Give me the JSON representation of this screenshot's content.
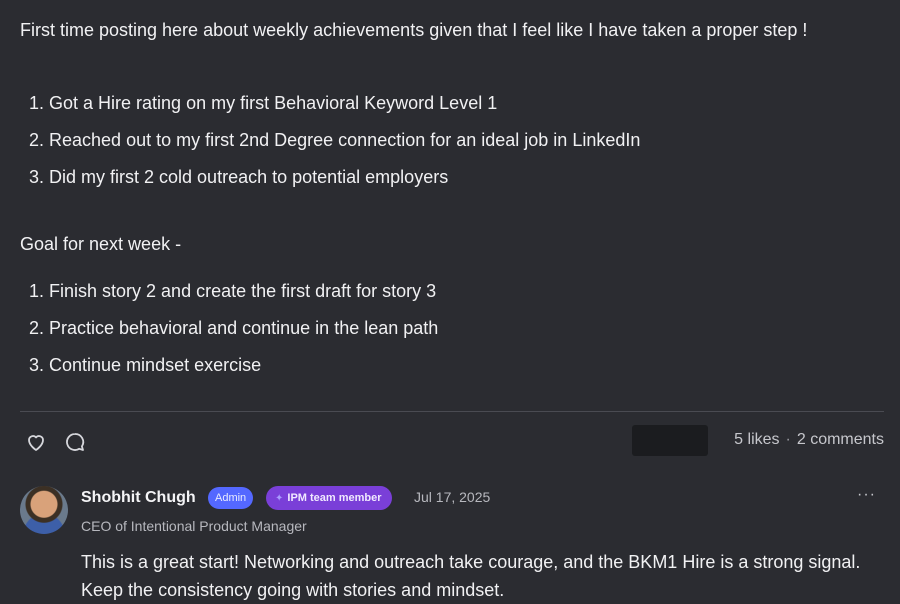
{
  "post": {
    "intro": "First time posting here about weekly achievements given that I feel like I have taken a proper step !",
    "achievements": [
      "1. Got a Hire rating on my first Behavioral Keyword Level 1",
      "2. Reached out to my first 2nd Degree connection for an ideal job in LinkedIn",
      "3. Did my first 2 cold outreach to potential employers"
    ],
    "goal_heading": "Goal for next week -",
    "goals": [
      "1. Finish story 2 and create the first draft for story 3",
      "2. Practice behavioral and continue in the lean path",
      "3. Continue mindset exercise"
    ]
  },
  "actions": {
    "heart_icon": "heart-icon",
    "comment_icon": "comment-icon",
    "likes": "5 likes",
    "separator": "·",
    "comments": "2 comments"
  },
  "reply": {
    "author": "Shobhit Chugh",
    "admin_badge": "Admin",
    "team_badge": "IPM team member",
    "date": "Jul 17, 2025",
    "more": "···",
    "role": "CEO of Intentional Product Manager",
    "text": "This is a great start! Networking and outreach take courage, and the BKM1 Hire is a strong signal. Keep the consistency going with stories and mindset."
  },
  "colors": {
    "background": "#2b2c31",
    "admin_badge": "#5468ff",
    "team_badge": "#7a3fd8"
  }
}
